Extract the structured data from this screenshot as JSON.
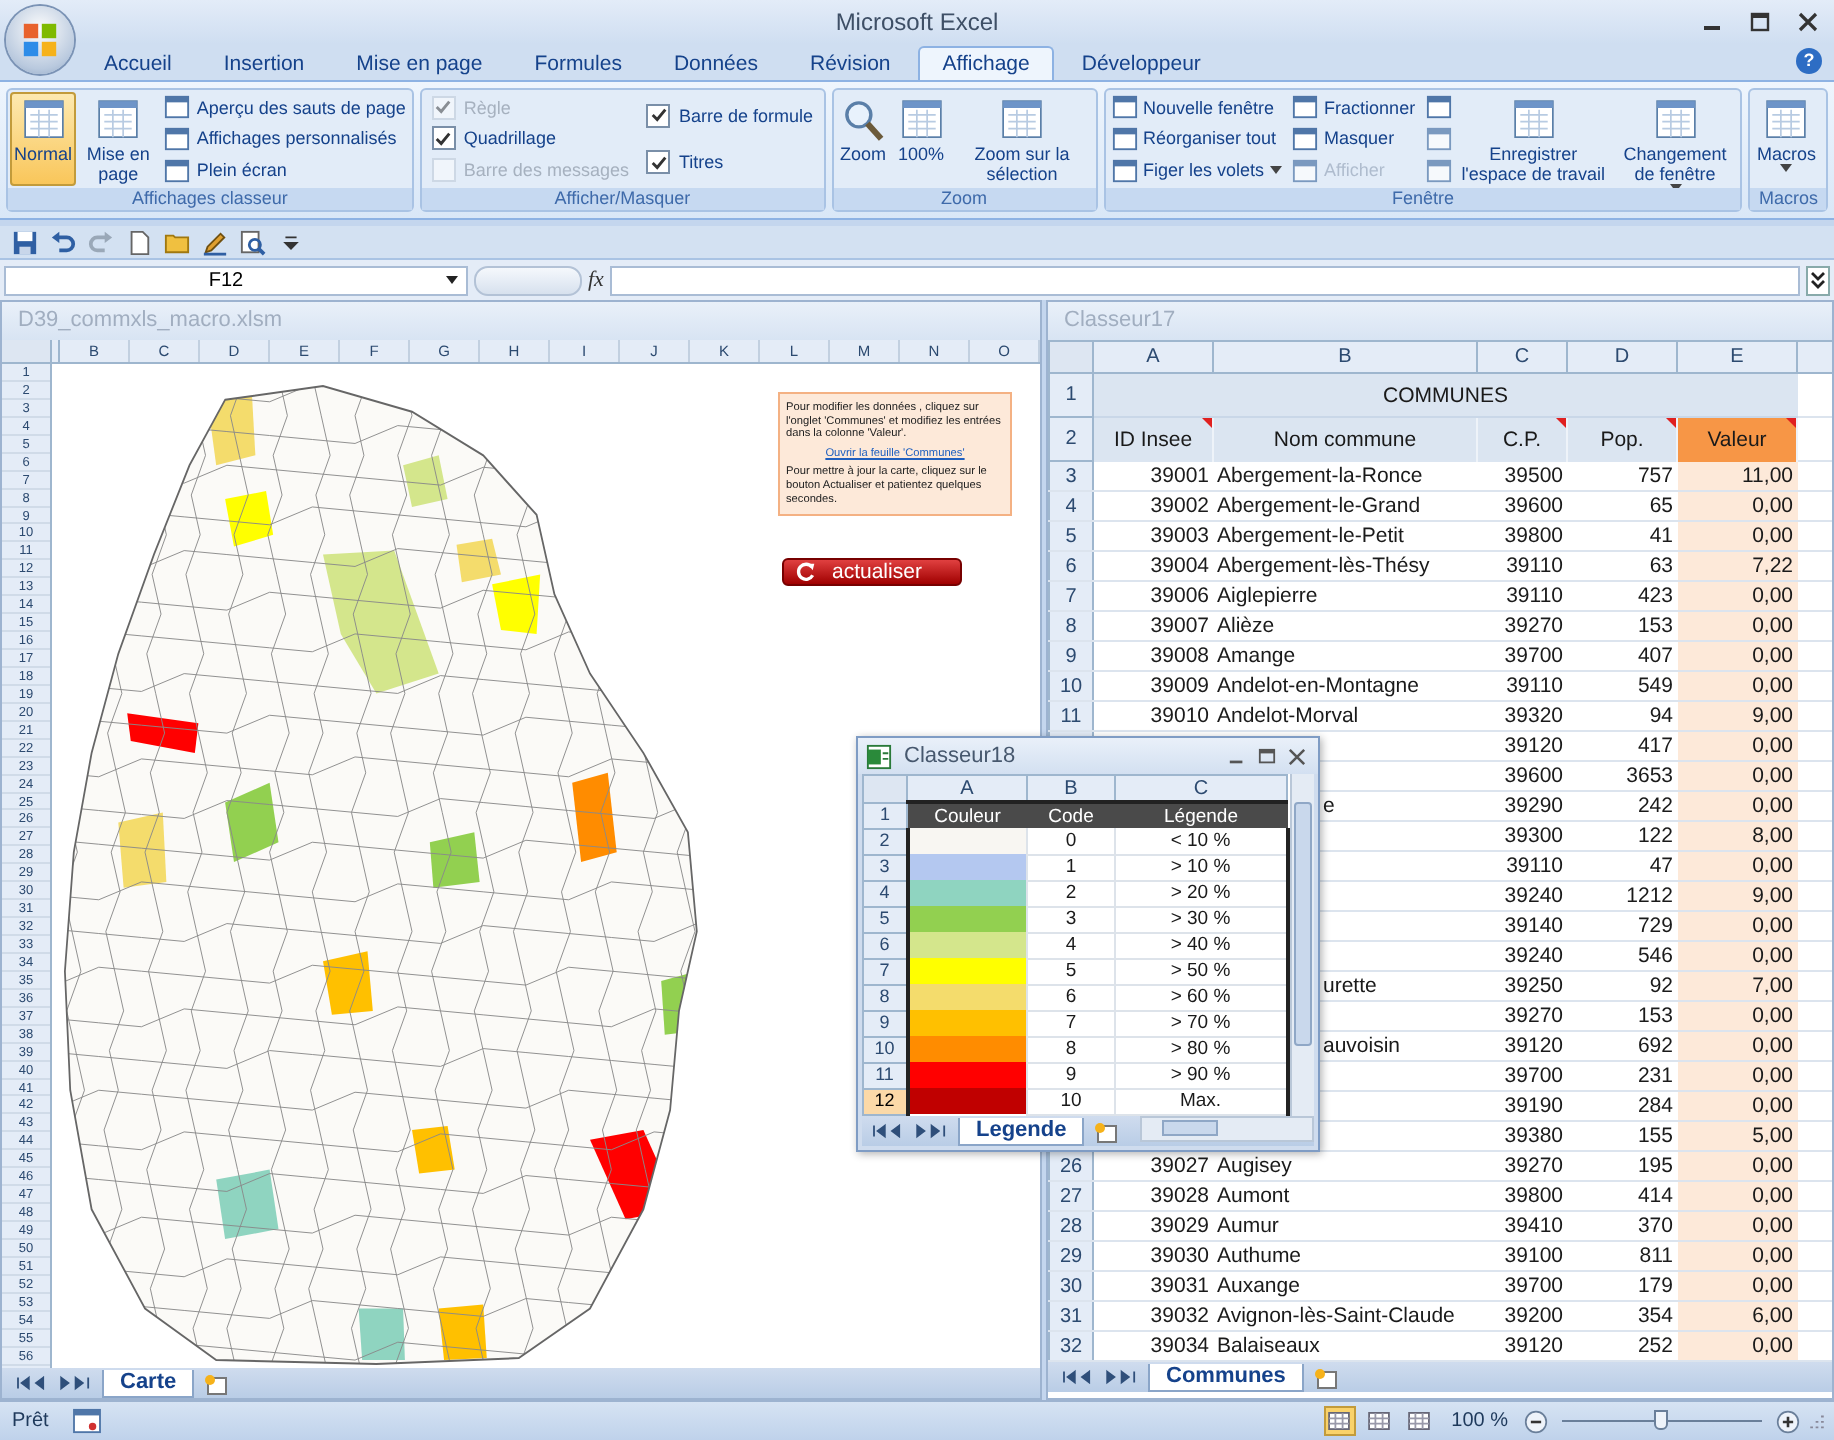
{
  "window": {
    "title": "Microsoft Excel",
    "help": "?"
  },
  "ribbon": {
    "tabs": [
      {
        "label": "Accueil",
        "selected": false
      },
      {
        "label": "Insertion",
        "selected": false
      },
      {
        "label": "Mise en page",
        "selected": false
      },
      {
        "label": "Formules",
        "selected": false
      },
      {
        "label": "Données",
        "selected": false
      },
      {
        "label": "Révision",
        "selected": false
      },
      {
        "label": "Affichage",
        "selected": true
      },
      {
        "label": "Développeur",
        "selected": false
      }
    ],
    "groups": [
      {
        "label": "Affichages classeur",
        "items": [
          {
            "kind": "large",
            "label": "Normal",
            "selected": true,
            "dropdown": false
          },
          {
            "kind": "large",
            "label": "Mise en page",
            "selected": false,
            "dropdown": false
          },
          {
            "kind": "small",
            "label": "Aperçu des sauts de page",
            "disabled": false,
            "dropdown": false
          },
          {
            "kind": "small",
            "label": "Affichages personnalisés",
            "disabled": false,
            "dropdown": false
          },
          {
            "kind": "small",
            "label": "Plein écran",
            "disabled": false,
            "dropdown": false
          }
        ]
      },
      {
        "label": "Afficher/Masquer",
        "items": [
          {
            "kind": "check",
            "label": "Règle",
            "checked": true,
            "disabled": true
          },
          {
            "kind": "check",
            "label": "Quadrillage",
            "checked": true,
            "disabled": false
          },
          {
            "kind": "check",
            "label": "Barre des messages",
            "checked": false,
            "disabled": true
          },
          {
            "kind": "check",
            "label": "Barre de formule",
            "checked": true,
            "disabled": false
          },
          {
            "kind": "check",
            "label": "Titres",
            "checked": true,
            "disabled": false
          }
        ]
      },
      {
        "label": "Zoom",
        "items": [
          {
            "kind": "large",
            "label": "Zoom",
            "selected": false,
            "dropdown": false
          },
          {
            "kind": "large",
            "label": "100%",
            "selected": false,
            "dropdown": false
          },
          {
            "kind": "large",
            "label": "Zoom sur la sélection",
            "selected": false,
            "dropdown": false
          }
        ]
      },
      {
        "label": "Fenêtre",
        "items": [
          {
            "kind": "small",
            "label": "Nouvelle fenêtre",
            "disabled": false,
            "dropdown": false
          },
          {
            "kind": "small",
            "label": "Réorganiser tout",
            "disabled": false,
            "dropdown": false
          },
          {
            "kind": "small",
            "label": "Figer les volets",
            "disabled": false,
            "dropdown": true
          },
          {
            "kind": "small",
            "label": "Fractionner",
            "disabled": false,
            "dropdown": false
          },
          {
            "kind": "small",
            "label": "Masquer",
            "disabled": false,
            "dropdown": false
          },
          {
            "kind": "small",
            "label": "Afficher",
            "disabled": true,
            "dropdown": false
          },
          {
            "kind": "icon",
            "disabled": false
          },
          {
            "kind": "icon",
            "disabled": true
          },
          {
            "kind": "icon",
            "disabled": true
          },
          {
            "kind": "large",
            "label": "Enregistrer l'espace de travail",
            "selected": false,
            "dropdown": false
          },
          {
            "kind": "large",
            "label": "Changement de fenêtre",
            "selected": false,
            "dropdown": true
          }
        ]
      },
      {
        "label": "Macros",
        "items": [
          {
            "kind": "large",
            "label": "Macros",
            "selected": false,
            "dropdown": true
          }
        ]
      }
    ]
  },
  "formula_bar": {
    "name_box": "F12",
    "fx": "fx"
  },
  "left_pane": {
    "title": "D39_commxls_macro.xlsm",
    "columns": [
      "B",
      "C",
      "D",
      "E",
      "F",
      "G",
      "H",
      "I",
      "J",
      "K",
      "L",
      "M",
      "N",
      "O"
    ],
    "row_numbers": [
      "1",
      "2",
      "3",
      "4",
      "5",
      "6",
      "7",
      "8",
      "9",
      "10",
      "11",
      "12",
      "13",
      "14",
      "15",
      "16",
      "17",
      "18",
      "19",
      "20",
      "21",
      "22",
      "23",
      "24",
      "25",
      "26",
      "27",
      "28",
      "29",
      "30",
      "31",
      "32",
      "33",
      "34",
      "35",
      "36",
      "37",
      "38",
      "39",
      "40",
      "41",
      "42",
      "43",
      "44",
      "45",
      "46",
      "47",
      "48",
      "49",
      "50",
      "51",
      "52",
      "53",
      "54",
      "55",
      "56"
    ],
    "note": {
      "paragraph_1": "Pour modifier les données , cliquez sur l'onglet 'Communes' et modifiez les entrées dans la colonne 'Valeur'.",
      "link": "Ouvrir la feuille 'Communes'",
      "paragraph_2": "Pour mettre à jour la carte, cliquez sur le bouton Actualiser et patientez quelques secondes."
    },
    "button": "actualiser",
    "sheet_tabs": [
      {
        "label": "Carte",
        "selected": true
      }
    ]
  },
  "right_pane": {
    "title": "Classeur17",
    "columns": [
      {
        "letter": "A",
        "header": "ID Insee",
        "comment": true,
        "highlight": false
      },
      {
        "letter": "B",
        "header": "Nom commune",
        "comment": false,
        "highlight": false
      },
      {
        "letter": "C",
        "header": "C.P.",
        "comment": true,
        "highlight": false
      },
      {
        "letter": "D",
        "header": "Pop.",
        "comment": true,
        "highlight": false
      },
      {
        "letter": "E",
        "header": "Valeur",
        "comment": true,
        "highlight": true
      }
    ],
    "title_row": {
      "n": "1",
      "text": "COMMUNES"
    },
    "header_row_number": "2",
    "rows": [
      {
        "n": "3",
        "id": "39001",
        "name": "Abergement-la-Ronce",
        "cp": "39500",
        "pop": "757",
        "value": "11,00"
      },
      {
        "n": "4",
        "id": "39002",
        "name": "Abergement-le-Grand",
        "cp": "39600",
        "pop": "65",
        "value": "0,00"
      },
      {
        "n": "5",
        "id": "39003",
        "name": "Abergement-le-Petit",
        "cp": "39800",
        "pop": "41",
        "value": "0,00"
      },
      {
        "n": "6",
        "id": "39004",
        "name": "Abergement-lès-Thésy",
        "cp": "39110",
        "pop": "63",
        "value": "7,22"
      },
      {
        "n": "7",
        "id": "39006",
        "name": "Aiglepierre",
        "cp": "39110",
        "pop": "423",
        "value": "0,00"
      },
      {
        "n": "8",
        "id": "39007",
        "name": "Alièze",
        "cp": "39270",
        "pop": "153",
        "value": "0,00"
      },
      {
        "n": "9",
        "id": "39008",
        "name": "Amange",
        "cp": "39700",
        "pop": "407",
        "value": "0,00"
      },
      {
        "n": "10",
        "id": "39009",
        "name": "Andelot-en-Montagne",
        "cp": "39110",
        "pop": "549",
        "value": "0,00"
      },
      {
        "n": "11",
        "id": "39010",
        "name": "Andelot-Morval",
        "cp": "39320",
        "pop": "94",
        "value": "9,00"
      },
      {
        "cp": "39120",
        "pop": "417",
        "value": "0,00"
      },
      {
        "cp": "39600",
        "pop": "3653",
        "value": "0,00"
      },
      {
        "name_fragment": "e",
        "cp": "39290",
        "pop": "242",
        "value": "0,00"
      },
      {
        "cp": "39300",
        "pop": "122",
        "value": "8,00"
      },
      {
        "cp": "39110",
        "pop": "47",
        "value": "0,00"
      },
      {
        "cp": "39240",
        "pop": "1212",
        "value": "9,00"
      },
      {
        "cp": "39140",
        "pop": "729",
        "value": "0,00"
      },
      {
        "cp": "39240",
        "pop": "546",
        "value": "0,00"
      },
      {
        "name_fragment": "urette",
        "cp": "39250",
        "pop": "92",
        "value": "7,00"
      },
      {
        "cp": "39270",
        "pop": "153",
        "value": "0,00"
      },
      {
        "name_fragment": "auvoisin",
        "cp": "39120",
        "pop": "692",
        "value": "0,00"
      },
      {
        "cp": "39700",
        "pop": "231",
        "value": "0,00"
      },
      {
        "cp": "39190",
        "pop": "284",
        "value": "0,00"
      },
      {
        "cp": "39380",
        "pop": "155",
        "value": "5,00"
      },
      {
        "n": "26",
        "id": "39027",
        "name": "Augisey",
        "cp": "39270",
        "pop": "195",
        "value": "0,00"
      },
      {
        "n": "27",
        "id": "39028",
        "name": "Aumont",
        "cp": "39800",
        "pop": "414",
        "value": "0,00"
      },
      {
        "n": "28",
        "id": "39029",
        "name": "Aumur",
        "cp": "39410",
        "pop": "370",
        "value": "0,00"
      },
      {
        "n": "29",
        "id": "39030",
        "name": "Authume",
        "cp": "39100",
        "pop": "811",
        "value": "0,00"
      },
      {
        "n": "30",
        "id": "39031",
        "name": "Auxange",
        "cp": "39700",
        "pop": "179",
        "value": "0,00"
      },
      {
        "n": "31",
        "id": "39032",
        "name": "Avignon-lès-Saint-Claude",
        "cp": "39200",
        "pop": "354",
        "value": "6,00"
      },
      {
        "n": "32",
        "id": "39034",
        "name": "Balaiseaux",
        "cp": "39120",
        "pop": "252",
        "value": "0,00"
      }
    ],
    "sheet_tabs": [
      {
        "label": "Communes",
        "selected": true
      }
    ]
  },
  "legend_window": {
    "title": "Classeur18",
    "columns": [
      "A",
      "B",
      "C"
    ],
    "header": {
      "n": "1",
      "cells": [
        "Couleur",
        "Code",
        "Légende"
      ]
    },
    "rows": [
      {
        "n": "2",
        "color": "#f8f6f2",
        "code": "0",
        "label": "< 10 %",
        "selected": false
      },
      {
        "n": "3",
        "color": "#b4c8f0",
        "code": "1",
        "label": "> 10 %",
        "selected": false
      },
      {
        "n": "4",
        "color": "#8fd4c0",
        "code": "2",
        "label": "> 20 %",
        "selected": false
      },
      {
        "n": "5",
        "color": "#92d050",
        "code": "3",
        "label": "> 30 %",
        "selected": false
      },
      {
        "n": "6",
        "color": "#d4e68c",
        "code": "4",
        "label": "> 40 %",
        "selected": false
      },
      {
        "n": "7",
        "color": "#ffff00",
        "code": "5",
        "label": "> 50 %",
        "selected": false
      },
      {
        "n": "8",
        "color": "#f4dc6c",
        "code": "6",
        "label": "> 60 %",
        "selected": false
      },
      {
        "n": "9",
        "color": "#ffc000",
        "code": "7",
        "label": "> 70 %",
        "selected": false
      },
      {
        "n": "10",
        "color": "#ff8c00",
        "code": "8",
        "label": "> 80 %",
        "selected": false
      },
      {
        "n": "11",
        "color": "#ff0000",
        "code": "9",
        "label": "> 90 %",
        "selected": false
      },
      {
        "n": "12",
        "color": "#c00000",
        "code": "10",
        "label": "Max.",
        "selected": true
      }
    ],
    "sheet_tabs": [
      {
        "label": "Legende",
        "selected": true
      }
    ]
  },
  "status_bar": {
    "status": "Prêt",
    "views": [
      {
        "selected": true
      },
      {
        "selected": false
      },
      {
        "selected": false
      }
    ],
    "zoom": "100 %",
    "zoom_slider": {
      "level": 0.5
    }
  }
}
